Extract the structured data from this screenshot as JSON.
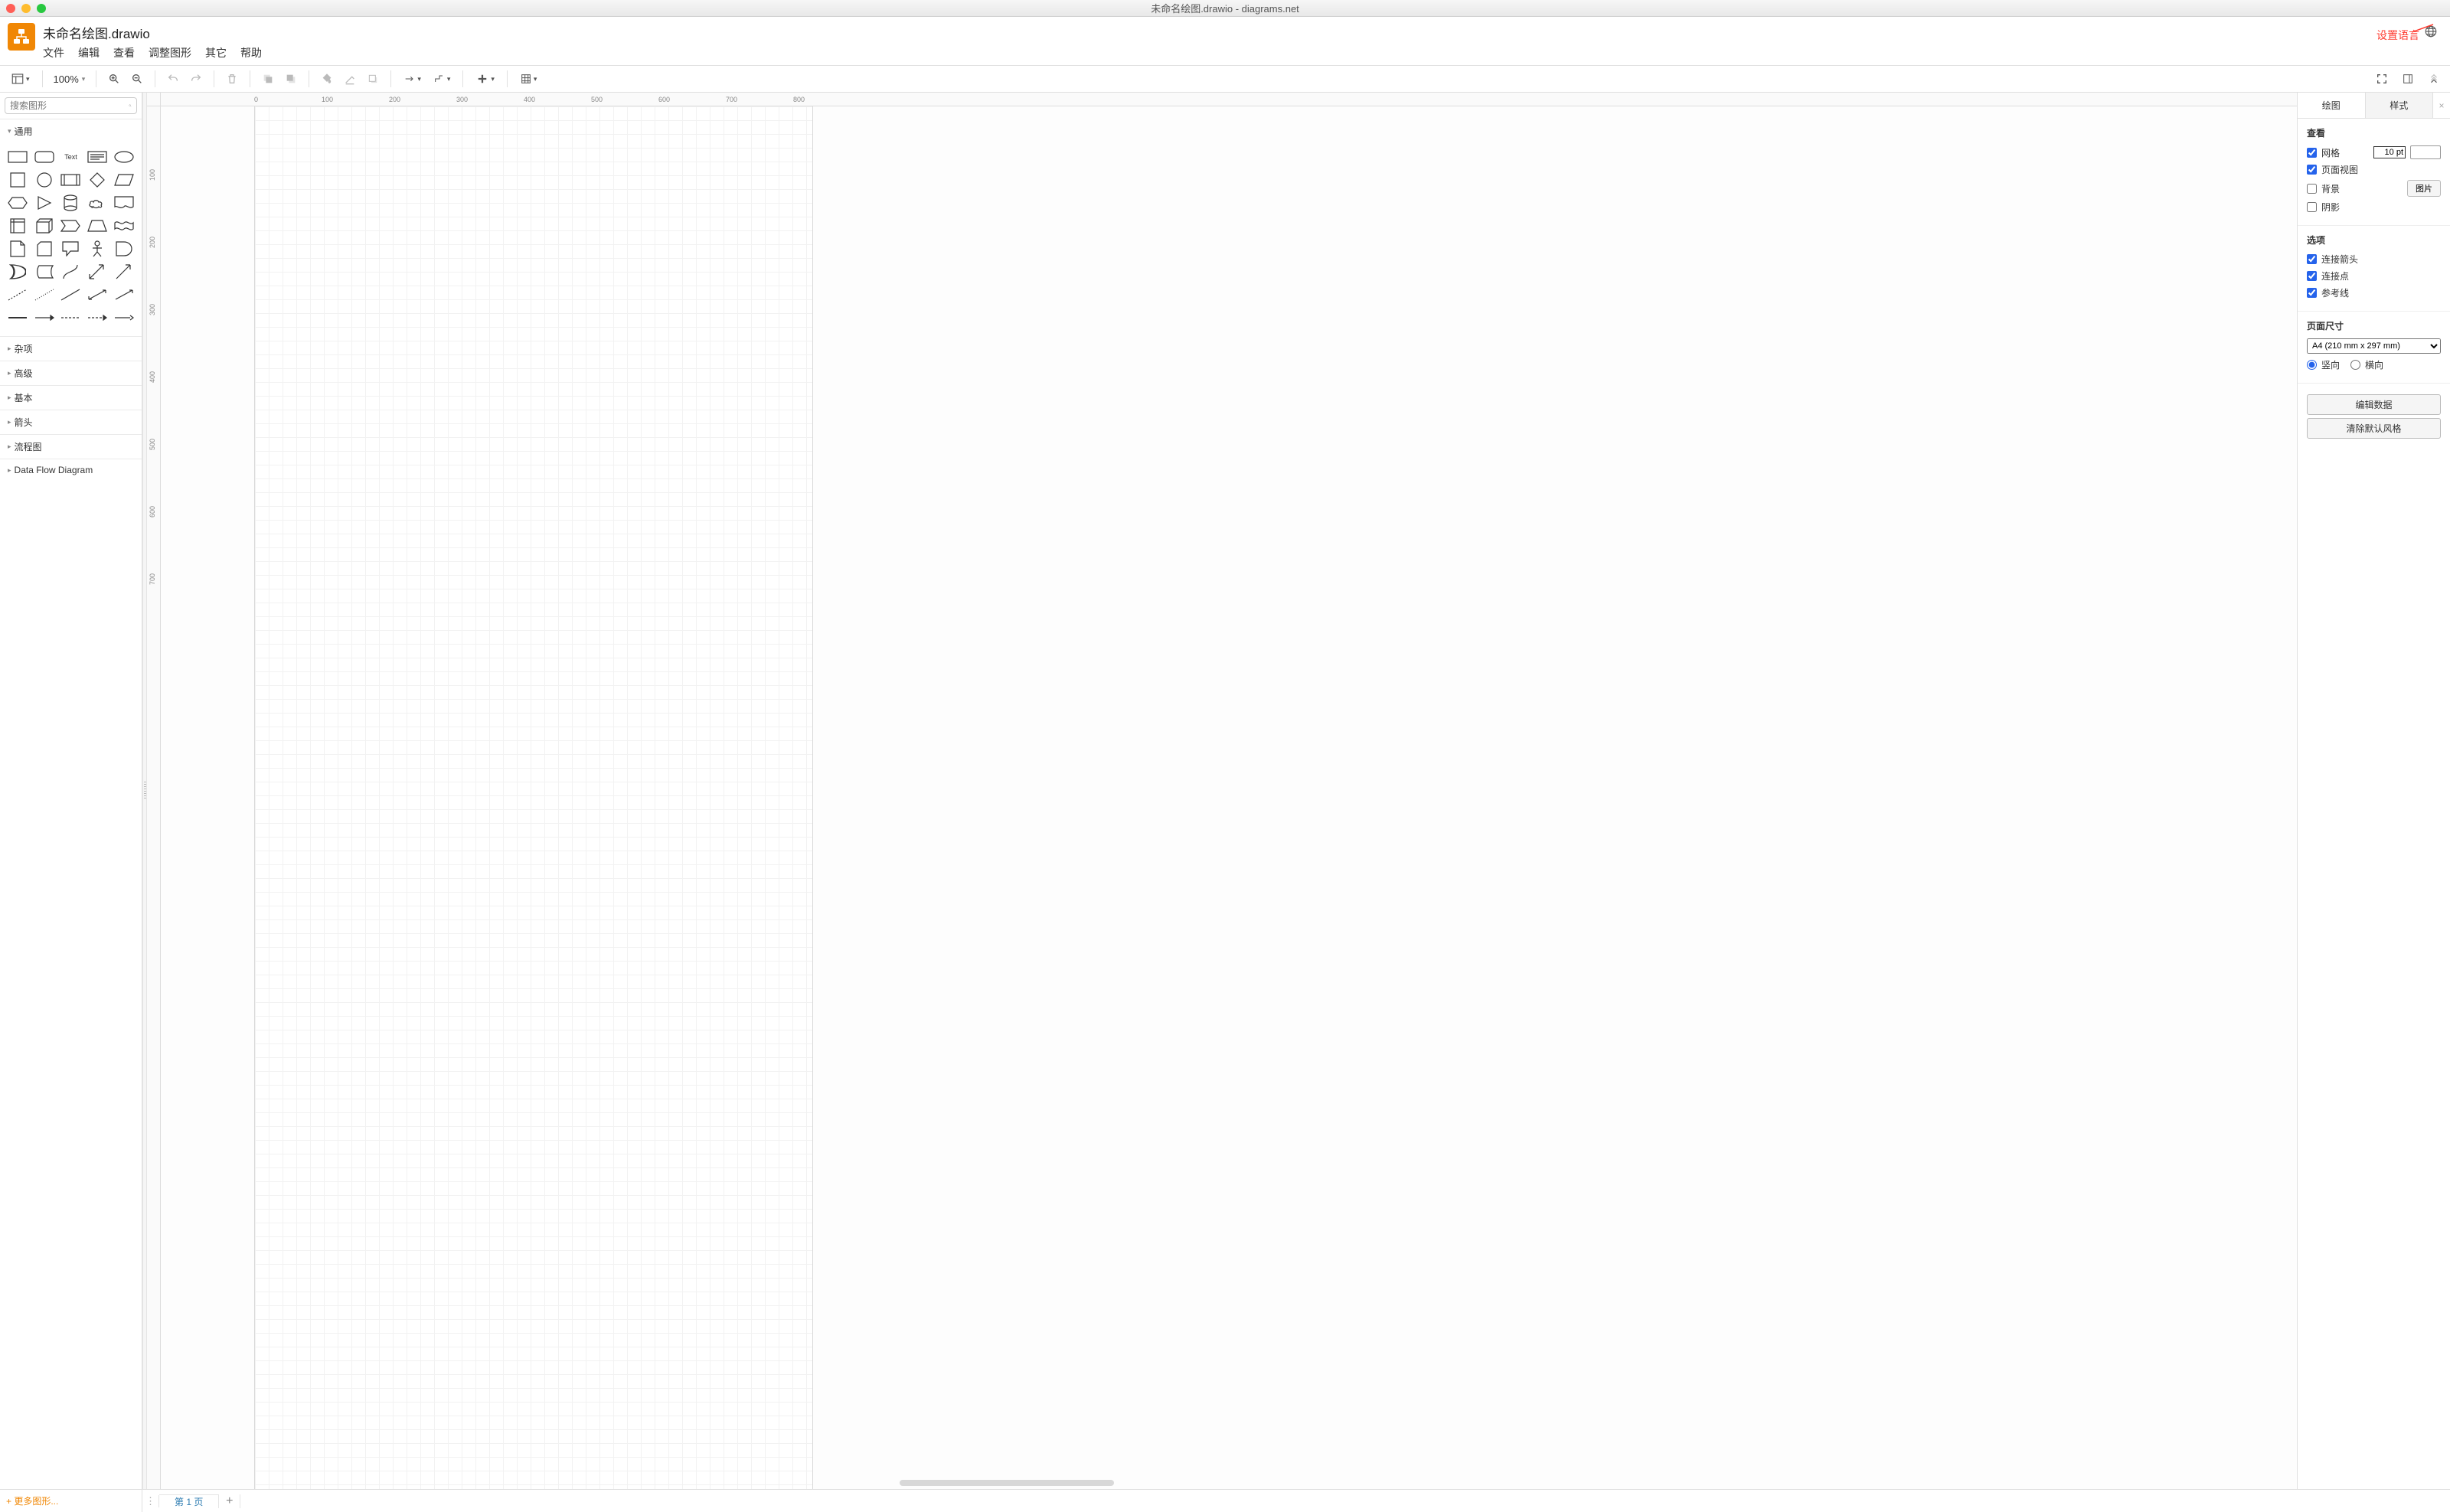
{
  "window": {
    "title": "未命名绘图.drawio - diagrams.net"
  },
  "document": {
    "title": "未命名绘图.drawio"
  },
  "menu": {
    "file": "文件",
    "edit": "编辑",
    "view": "查看",
    "adjust": "调整图形",
    "other": "其它",
    "help": "帮助"
  },
  "toolbar": {
    "zoom": "100%"
  },
  "annotation": {
    "text": "设置语言"
  },
  "sidebar": {
    "search_placeholder": "搜索图形",
    "cat_general": "通用",
    "cat_misc": "杂项",
    "cat_advanced": "高级",
    "cat_basic": "基本",
    "cat_arrows": "箭头",
    "cat_flowchart": "流程图",
    "cat_dfd": "Data Flow Diagram",
    "more_shapes": "+ 更多图形..."
  },
  "ruler_h": [
    "0",
    "100",
    "200",
    "300",
    "400",
    "500",
    "600",
    "700",
    "800"
  ],
  "ruler_v": [
    "100",
    "200",
    "300",
    "400",
    "500",
    "600",
    "700"
  ],
  "pages": {
    "page1": "第 1 页"
  },
  "panel": {
    "tab_diagram": "绘图",
    "tab_style": "样式",
    "sec_view": "查看",
    "grid": "网格",
    "grid_size": "10 pt",
    "page_view": "页面视图",
    "background": "背景",
    "image_btn": "图片",
    "shadow": "阴影",
    "sec_options": "选项",
    "conn_arrow": "连接箭头",
    "conn_point": "连接点",
    "guides": "参考线",
    "sec_pagesize": "页面尺寸",
    "pagesize_value": "A4 (210 mm x 297 mm)",
    "portrait": "竖向",
    "landscape": "横向",
    "edit_data": "编辑数据",
    "clear_style": "清除默认风格"
  }
}
